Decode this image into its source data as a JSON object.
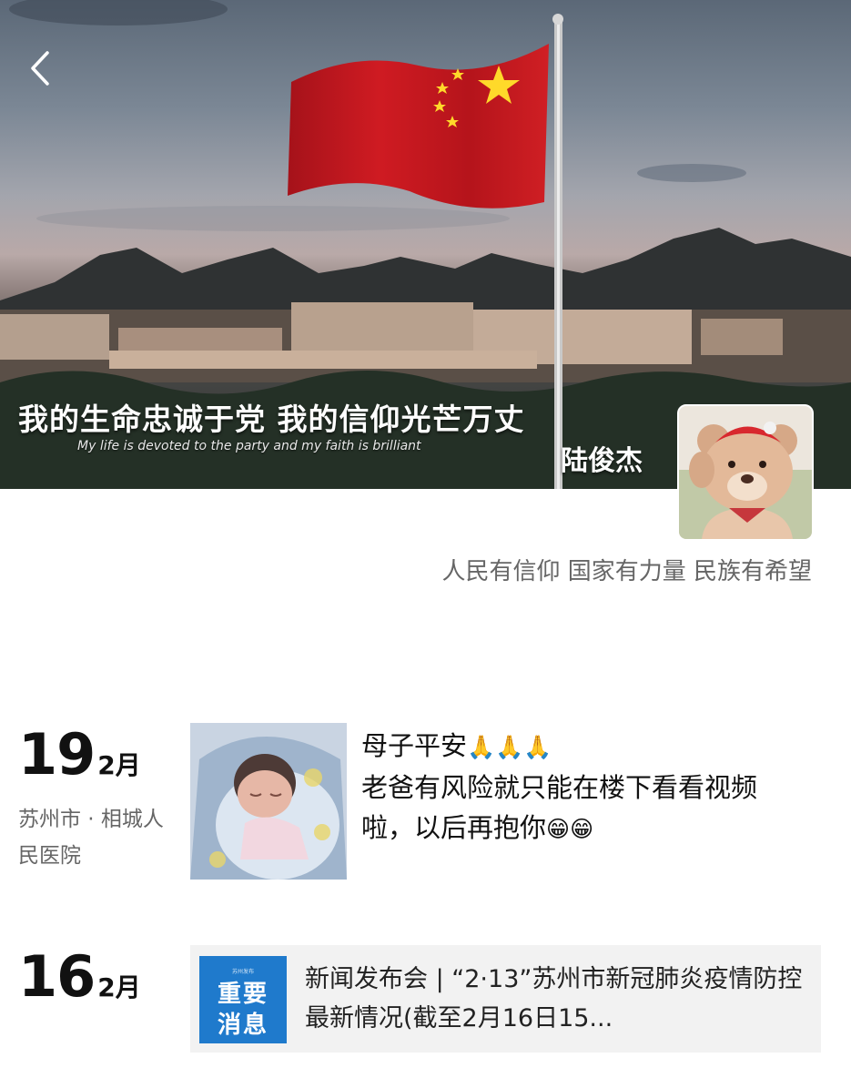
{
  "profile": {
    "username": "陆俊杰",
    "signature": "人民有信仰 国家有力量 民族有希望"
  },
  "cover": {
    "slogan_zh": "我的生命忠诚于党 我的信仰光芒万丈",
    "slogan_en": "My life is devoted to the party and my faith is brilliant"
  },
  "posts": [
    {
      "day": "19",
      "month": "2月",
      "location": "苏州市 · 相城人民医院",
      "text_line1": "母子平安",
      "text_line1_emoji": "🙏🙏🙏",
      "text_line2": "老爸有风险就只能在楼下看看视频",
      "text_line3": "啦，以后再抱你",
      "text_line3_emoji": "😁😁"
    },
    {
      "day": "16",
      "month": "2月",
      "link": {
        "thumb_header": "苏州发布",
        "thumb_line1": "重要",
        "thumb_line2": "消息",
        "title": "新闻发布会 | “2·13”苏州市新冠肺炎疫情防控最新情况(截至2月16日15..."
      }
    }
  ],
  "colors": {
    "flag_red": "#c8161d",
    "flag_star": "#ffd92a",
    "link_card_bg": "#f2f2f2",
    "link_thumb_bg": "#1f7acc",
    "muted_text": "#666666"
  },
  "icons": {
    "back": "chevron-left-icon"
  }
}
